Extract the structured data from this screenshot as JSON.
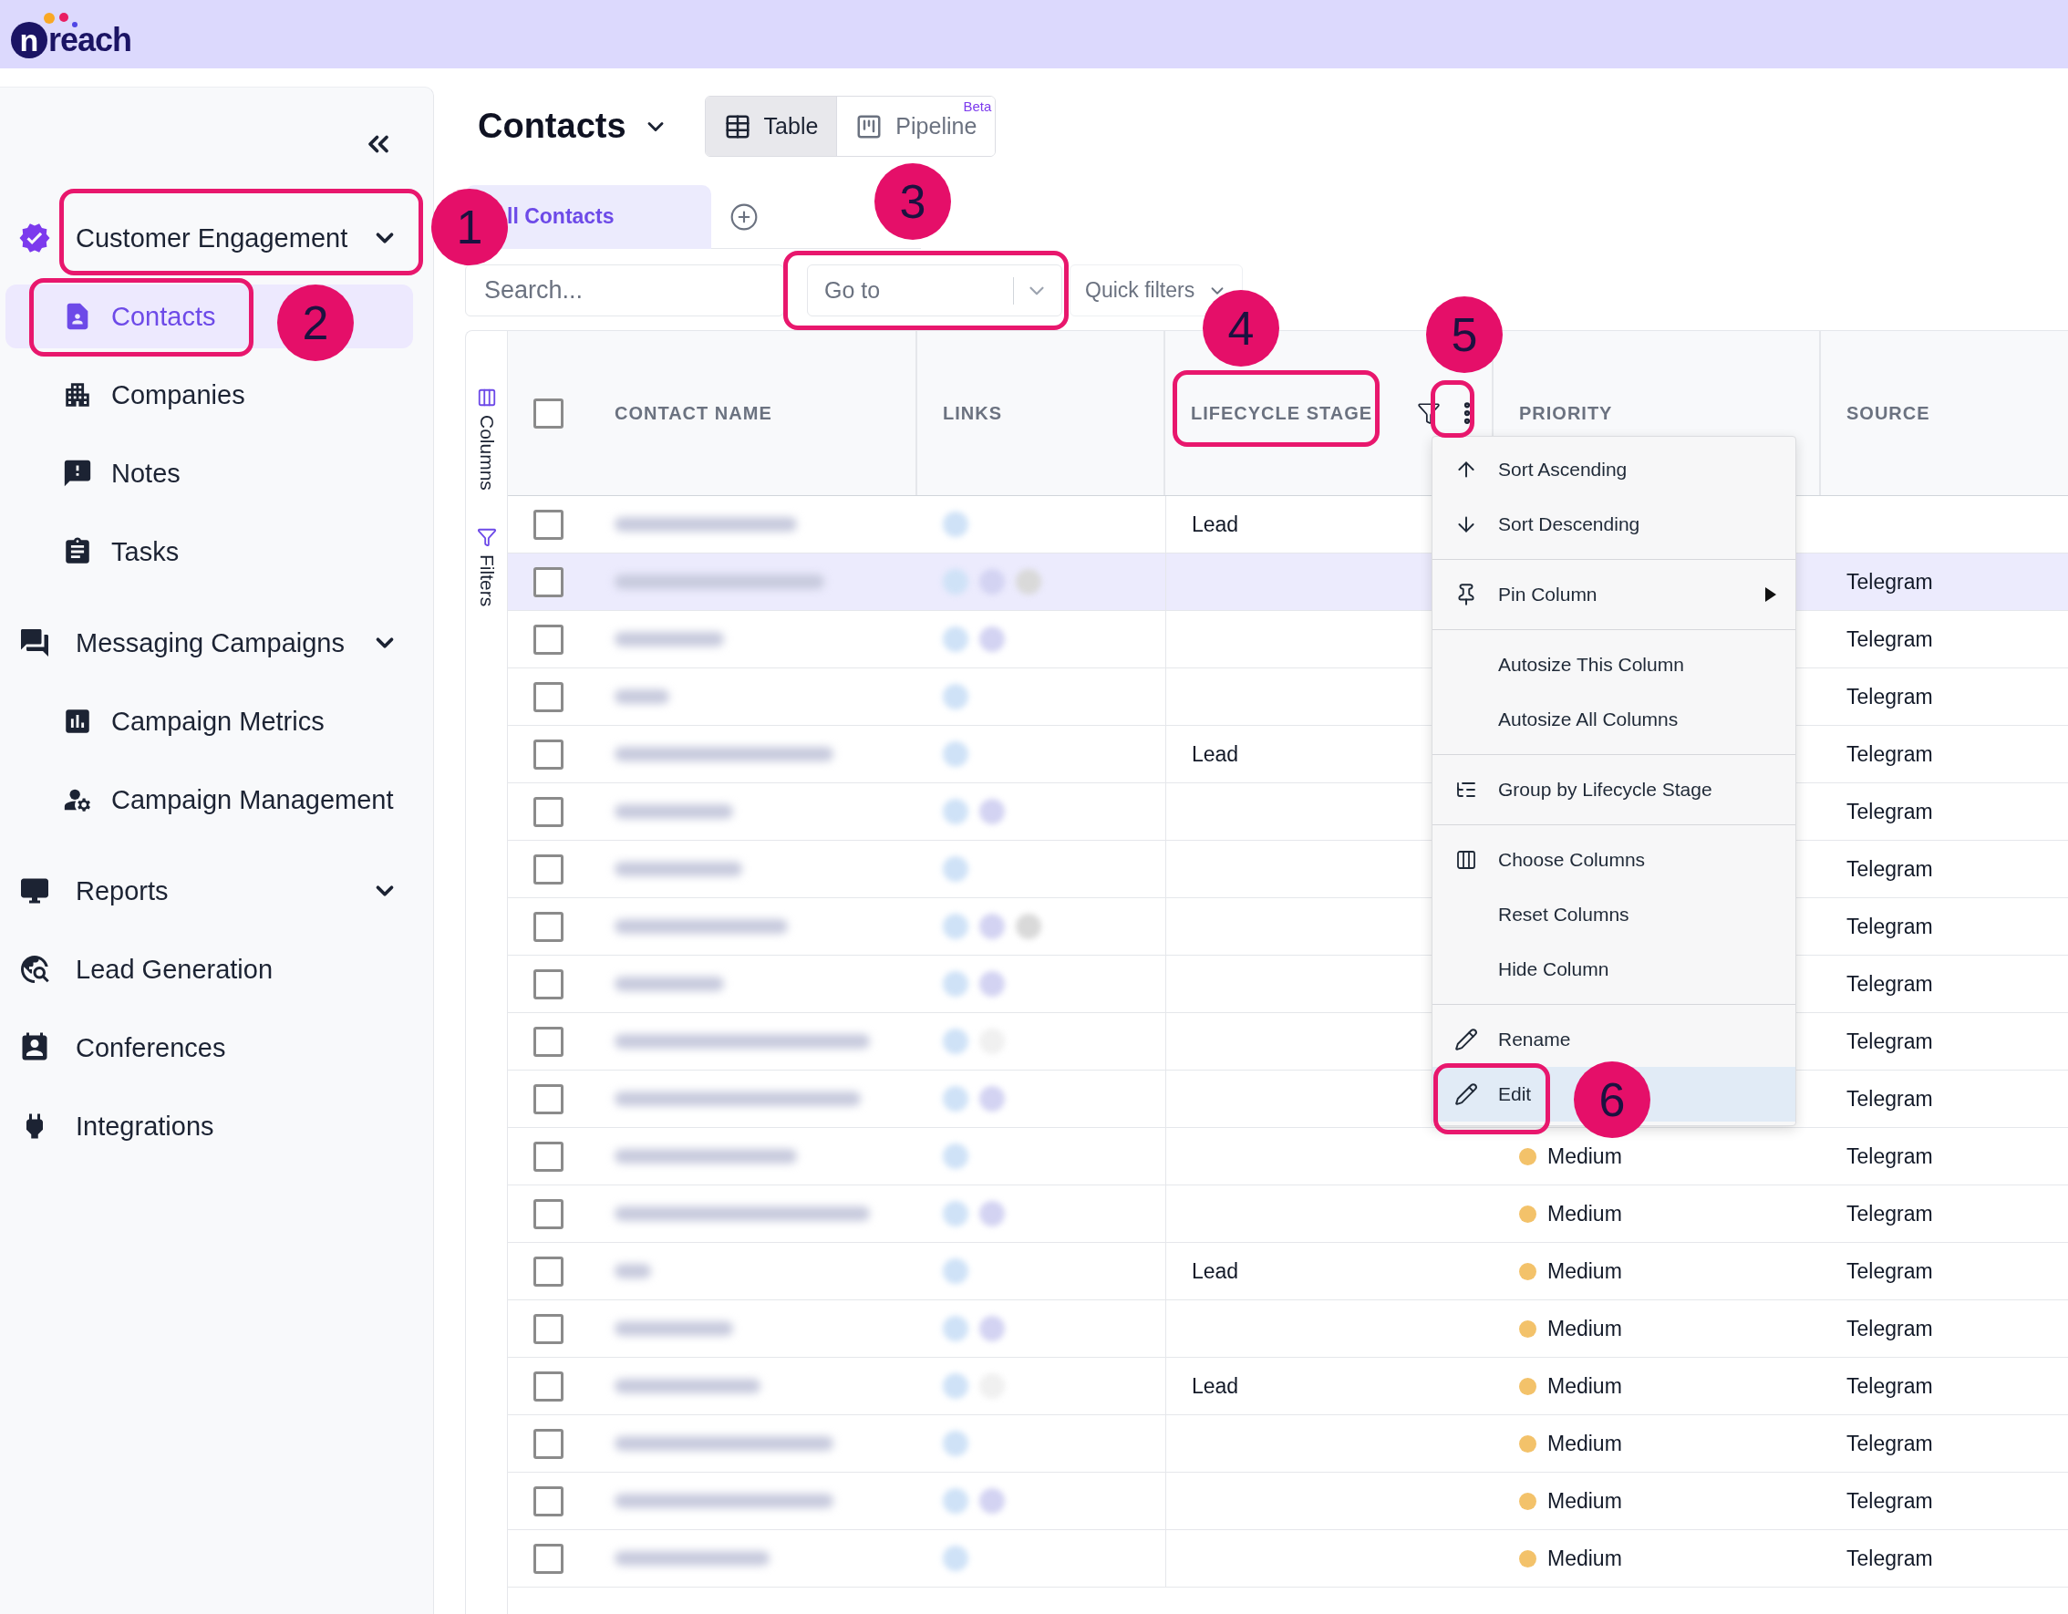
{
  "app": {
    "logo_letter": "n",
    "logo_text": "reach"
  },
  "sidebar": {
    "items": [
      {
        "label": "Customer Engagement",
        "collapsible": true,
        "children": [
          {
            "label": "Contacts",
            "selected": true
          },
          {
            "label": "Companies",
            "selected": false
          },
          {
            "label": "Notes",
            "selected": false
          },
          {
            "label": "Tasks",
            "selected": false
          }
        ]
      },
      {
        "label": "Messaging Campaigns",
        "collapsible": true,
        "children": [
          {
            "label": "Campaign Metrics",
            "selected": false
          },
          {
            "label": "Campaign Management",
            "selected": false
          }
        ]
      },
      {
        "label": "Reports",
        "collapsible": true
      },
      {
        "label": "Lead Generation",
        "collapsible": false
      },
      {
        "label": "Conferences",
        "collapsible": false
      },
      {
        "label": "Integrations",
        "collapsible": false
      }
    ]
  },
  "page": {
    "title": "Contacts",
    "views": [
      {
        "label": "Table",
        "selected": true
      },
      {
        "label": "Pipeline",
        "selected": false,
        "badge": "Beta"
      }
    ]
  },
  "tabs": [
    {
      "label": "ll Contacts",
      "selected": true
    }
  ],
  "toolbar": {
    "search": {
      "placeholder": "Search..."
    },
    "goto": {
      "placeholder": "Go to"
    },
    "quick_filters": "Quick filters"
  },
  "side_panel": [
    "Columns",
    "Filters"
  ],
  "table": {
    "header_checked": false,
    "columns": [
      "CONTACT NAME",
      "LINKS",
      "LIFECYCLE STAGE",
      "PRIORITY",
      "SOURCE"
    ],
    "rows": [
      {
        "checked": false,
        "highlighted": false,
        "links": [
          {
            "color": "#cfe2f7"
          }
        ],
        "lifecycle": "Lead"
      },
      {
        "checked": false,
        "highlighted": true,
        "links": [
          {
            "color": "#cfe2f7"
          },
          {
            "color": "#d3d3f2"
          },
          {
            "color": "#d9d9d9"
          }
        ],
        "source": "Telegram"
      },
      {
        "checked": false,
        "highlighted": false,
        "links": [
          {
            "color": "#cfe2f7"
          },
          {
            "color": "#d3d3f2"
          }
        ],
        "source": "Telegram"
      },
      {
        "checked": false,
        "highlighted": false,
        "links": [
          {
            "color": "#cfe2f7"
          }
        ],
        "source": "Telegram"
      },
      {
        "checked": false,
        "highlighted": false,
        "links": [
          {
            "color": "#cfe2f7"
          }
        ],
        "lifecycle": "Lead",
        "source": "Telegram"
      },
      {
        "checked": false,
        "highlighted": false,
        "links": [
          {
            "color": "#cfe2f7"
          },
          {
            "color": "#d3d3f2"
          }
        ],
        "source": "Telegram"
      },
      {
        "checked": false,
        "highlighted": false,
        "links": [
          {
            "color": "#cfe2f7"
          }
        ],
        "source": "Telegram"
      },
      {
        "checked": false,
        "highlighted": false,
        "links": [
          {
            "color": "#cfe2f7"
          },
          {
            "color": "#d3d3f2"
          },
          {
            "color": "#d9d9d9"
          }
        ],
        "source": "Telegram"
      },
      {
        "checked": false,
        "highlighted": false,
        "links": [
          {
            "color": "#cfe2f7"
          },
          {
            "color": "#d3d3f2"
          }
        ],
        "source": "Telegram"
      },
      {
        "checked": false,
        "highlighted": false,
        "links": [
          {
            "color": "#cfe2f7"
          },
          {
            "color": "#f0f0f0"
          }
        ],
        "source": "Telegram"
      },
      {
        "checked": false,
        "highlighted": false,
        "links": [
          {
            "color": "#cfe2f7"
          },
          {
            "color": "#d3d3f2"
          }
        ],
        "source": "Telegram"
      },
      {
        "checked": false,
        "highlighted": false,
        "links": [
          {
            "color": "#cfe2f7"
          }
        ],
        "priority": {
          "label": "Medium",
          "color": "#f3c26a"
        },
        "source": "Telegram"
      },
      {
        "checked": false,
        "highlighted": false,
        "links": [
          {
            "color": "#cfe2f7"
          },
          {
            "color": "#d3d3f2"
          }
        ],
        "priority": {
          "label": "Medium",
          "color": "#f3c26a"
        },
        "source": "Telegram"
      },
      {
        "checked": false,
        "highlighted": false,
        "links": [
          {
            "color": "#cfe2f7"
          }
        ],
        "lifecycle": "Lead",
        "priority": {
          "label": "Medium",
          "color": "#f3c26a"
        },
        "source": "Telegram"
      },
      {
        "checked": false,
        "highlighted": false,
        "links": [
          {
            "color": "#cfe2f7"
          },
          {
            "color": "#d3d3f2"
          }
        ],
        "priority": {
          "label": "Medium",
          "color": "#f3c26a"
        },
        "source": "Telegram"
      },
      {
        "checked": false,
        "highlighted": false,
        "links": [
          {
            "color": "#cfe2f7"
          },
          {
            "color": "#f0f0f0"
          }
        ],
        "lifecycle": "Lead",
        "priority": {
          "label": "Medium",
          "color": "#f3c26a"
        },
        "source": "Telegram"
      },
      {
        "checked": false,
        "highlighted": false,
        "links": [
          {
            "color": "#cfe2f7"
          }
        ],
        "priority": {
          "label": "Medium",
          "color": "#f3c26a"
        },
        "source": "Telegram"
      },
      {
        "checked": false,
        "highlighted": false,
        "links": [
          {
            "color": "#cfe2f7"
          },
          {
            "color": "#d3d3f2"
          }
        ],
        "priority": {
          "label": "Medium",
          "color": "#f3c26a"
        },
        "source": "Telegram"
      },
      {
        "checked": false,
        "highlighted": false,
        "links": [
          {
            "color": "#cfe2f7"
          }
        ],
        "priority": {
          "label": "Medium",
          "color": "#f3c26a"
        },
        "source": "Telegram"
      }
    ]
  },
  "column_menu": {
    "groups": [
      {
        "items": [
          {
            "label": "Sort Ascending",
            "highlighted": false,
            "submenu": false
          },
          {
            "label": "Sort Descending",
            "highlighted": false,
            "submenu": false
          }
        ]
      },
      {
        "items": [
          {
            "label": "Pin Column",
            "highlighted": false,
            "submenu": true
          }
        ]
      },
      {
        "items": [
          {
            "label": "Autosize This Column",
            "highlighted": false,
            "submenu": false
          },
          {
            "label": "Autosize All Columns",
            "highlighted": false,
            "submenu": false
          }
        ]
      },
      {
        "items": [
          {
            "label": "Group by Lifecycle Stage",
            "highlighted": false,
            "submenu": false
          }
        ]
      },
      {
        "items": [
          {
            "label": "Choose Columns",
            "highlighted": false,
            "submenu": false
          },
          {
            "label": "Reset Columns",
            "highlighted": false,
            "submenu": false
          },
          {
            "label": "Hide Column",
            "highlighted": false,
            "submenu": false
          }
        ]
      },
      {
        "items": [
          {
            "label": "Rename",
            "highlighted": false,
            "submenu": false
          },
          {
            "label": "Edit",
            "highlighted": true,
            "submenu": false
          }
        ]
      }
    ]
  },
  "annotations": [
    {
      "number": "1"
    },
    {
      "number": "2"
    },
    {
      "number": "3"
    },
    {
      "number": "4"
    },
    {
      "number": "5"
    },
    {
      "number": "6"
    }
  ]
}
